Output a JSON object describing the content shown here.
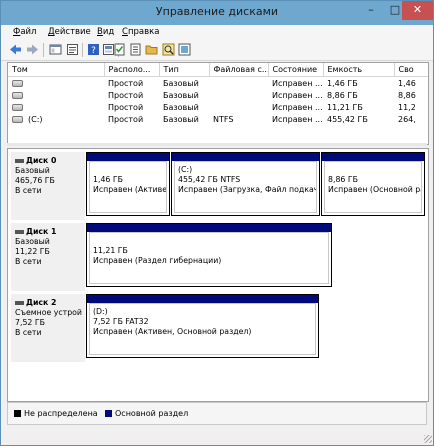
{
  "window": {
    "title": "Управление дисками",
    "min": "–",
    "max": "□",
    "close": "✕"
  },
  "menu": [
    {
      "ul": "Ф",
      "rest": "айл"
    },
    {
      "ul": "Д",
      "rest": "ействие"
    },
    {
      "ul": "В",
      "rest": "ид"
    },
    {
      "ul": "С",
      "rest": "правка"
    }
  ],
  "toolbar": [
    "back-icon",
    "forward-icon",
    "console-icon",
    "properties-icon",
    "help-icon",
    "view-icon",
    "checklist-icon",
    "open-icon",
    "folder-icon",
    "search-icon",
    "rescan-icon"
  ],
  "list": {
    "columns": [
      "Том",
      "Располо...",
      "Тип",
      "Файловая с...",
      "Состояние",
      "Емкость",
      "Сво"
    ],
    "rows": [
      [
        "",
        "Простой",
        "Базовый",
        "",
        "Исправен ...",
        "1,46 ГБ",
        "1,46"
      ],
      [
        "",
        "Простой",
        "Базовый",
        "",
        "Исправен ...",
        "8,86 ГБ",
        "8,86"
      ],
      [
        "",
        "Простой",
        "Базовый",
        "",
        "Исправен ...",
        "11,21 ГБ",
        "11,2"
      ],
      [
        "(C:)",
        "Простой",
        "Базовый",
        "NTFS",
        "Исправен ...",
        "455,42 ГБ",
        "264,"
      ]
    ]
  },
  "disks": [
    {
      "name": "Диск 0",
      "type": "Базовый",
      "size": "465,76 ГБ",
      "status": "В сети",
      "partitions": [
        {
          "label": "",
          "size": "1,46 ГБ",
          "status": "Исправен (Активе"
        },
        {
          "label": "(C:)",
          "size": "455,42 ГБ NTFS",
          "status": "Исправен (Загрузка, Файл подкачк"
        },
        {
          "label": "",
          "size": "8,86 ГБ",
          "status": "Исправен (Основной раз"
        }
      ]
    },
    {
      "name": "Диск 1",
      "type": "Базовый",
      "size": "11,22 ГБ",
      "status": "В сети",
      "partitions": [
        {
          "label": "",
          "size": "11,21 ГБ",
          "status": "Исправен (Раздел гибернации)"
        }
      ]
    },
    {
      "name": "Диск 2",
      "type": "Съемное устрой",
      "size": "7,52 ГБ",
      "status": "В сети",
      "partitions": [
        {
          "label": "(D:)",
          "size": "7,52 ГБ FAT32",
          "status": "Исправен (Активен, Основной раздел)"
        }
      ]
    }
  ],
  "legend": [
    {
      "label": "Не распределена",
      "color": "#000000"
    },
    {
      "label": "Основной раздел",
      "color": "#000a7a"
    }
  ]
}
